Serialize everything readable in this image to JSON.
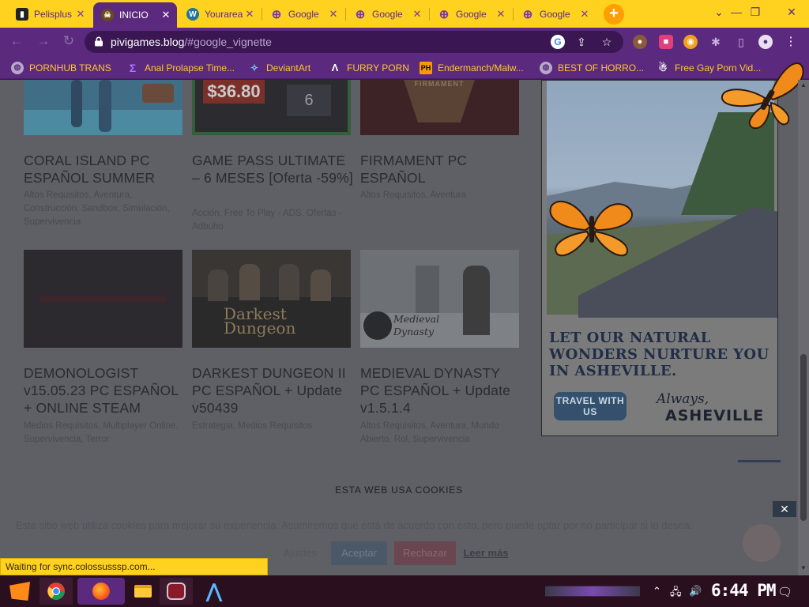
{
  "browser": {
    "tabs": [
      {
        "title": "Pelisplus",
        "active": false
      },
      {
        "title": "INICIO",
        "active": true
      },
      {
        "title": "Yourarea",
        "active": false
      },
      {
        "title": "Google",
        "active": false
      },
      {
        "title": "Google",
        "active": false
      },
      {
        "title": "Google",
        "active": false
      },
      {
        "title": "Google",
        "active": false
      }
    ],
    "new_tab_label": "+",
    "url_host": "pivigames.blog",
    "url_path": "/#google_vignette"
  },
  "bookmarks": [
    {
      "label": "PORNHUB TRANS"
    },
    {
      "label": "Anal Prolapse Time..."
    },
    {
      "label": "DeviantArt"
    },
    {
      "label": "FURRY PORN"
    },
    {
      "label": "Endermanch/Malw..."
    },
    {
      "label": "BEST OF HORRO..."
    },
    {
      "label": "Free Gay Porn Vid..."
    }
  ],
  "games_row1": [
    {
      "title": "CORAL ISLAND PC ESPAÑOL SUMMER",
      "tags": "Altos Requisitos, Aventura, Construcción, Sandbox, Simulación, Supervivencia"
    },
    {
      "title": "GAME PASS ULTIMATE – 6 MESES [Oferta -59%]",
      "tags": "Acción, Free To Play - ADS, Ofertas - Adbuho",
      "price": "$36.80",
      "thumb_number": "6"
    },
    {
      "title": "FIRMAMENT PC ESPAÑOL",
      "tags": "Altos Requisitos, Aventura",
      "thumb_text": "FIRMAMENT"
    }
  ],
  "games_row2": [
    {
      "title": "DEMONOLOGIST v15.05.23 PC ESPAÑOL + ONLINE STEAM",
      "tags": "Medios Requisitos, Multiplayer Online, Supervivencia, Terror"
    },
    {
      "title": "DARKEST DUNGEON II PC ESPAÑOL + Update v50439",
      "tags": "Estrategia, Medios Requisitos",
      "thumb_text": "Darkest Dungeon"
    },
    {
      "title": "MEDIEVAL DYNASTY PC ESPAÑOL + Update v1.5.1.4",
      "tags": "Altos Requisitos, Aventura, Mundo Abierto, Rol, Supervivencia",
      "thumb_text": "Medieval Dynasty"
    }
  ],
  "ad": {
    "headline": "LET OUR NATURAL WONDERS NURTURE YOU IN ASHEVILLE.",
    "button": "TRAVEL WITH US",
    "logo_script": "Always,",
    "logo_brand": "ASHEVILLE"
  },
  "cookie": {
    "title": "ESTA WEB USA COOKIES",
    "text": "Este sitio web utiliza cookies para mejorar su experiencia. Asumiremos que está de acuerdo con esto, pero puede optar por no participar si lo desea.",
    "accept": "Aceptar",
    "reject": "Rechazar",
    "more": "Leer más",
    "settings": "Ajustes",
    "close": "✕"
  },
  "status_text": "Waiting for sync.colossusssp.com...",
  "clock": "6:44 PM",
  "colors": {
    "tab_yellow": "#ffd21f",
    "chrome_purple": "#5b2a7f",
    "bookmark_text": "#ffc629"
  }
}
